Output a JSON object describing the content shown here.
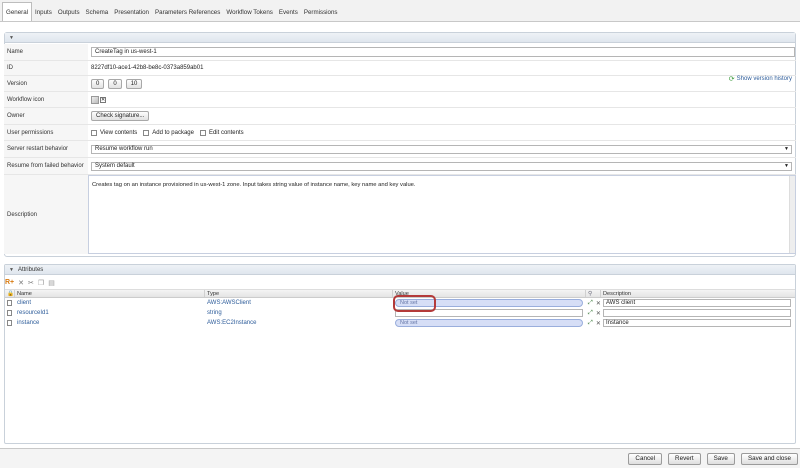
{
  "tabs": [
    "General",
    "Inputs",
    "Outputs",
    "Schema",
    "Presentation",
    "Parameters References",
    "Workflow Tokens",
    "Events",
    "Permissions"
  ],
  "general": {
    "name_label": "Name",
    "name_value": "CreateTag in us-west-1",
    "id_label": "ID",
    "id_value": "8227df10-ace1-42b8-be8c-0373a859ab01",
    "version_label": "Version",
    "version_parts": [
      "0",
      "0",
      "10"
    ],
    "show_version_history": "Show version history",
    "workflow_icon_label": "Workflow icon",
    "owner_label": "Owner",
    "check_signature": "Check signature...",
    "user_permissions_label": "User permissions",
    "permissions": [
      "View contents",
      "Add to package",
      "Edit contents"
    ],
    "server_restart_label": "Server restart behavior",
    "server_restart_value": "Resume workflow run",
    "resume_failed_label": "Resume from failed behavior",
    "resume_failed_value": "System default",
    "description_label": "Description",
    "description_value": "Creates tag on an instance provisioned in us-west-1 zone. Input takes string value of instance name, key name and key value."
  },
  "attributes": {
    "title": "Attributes",
    "columns": {
      "name": "Name",
      "type": "Type",
      "value": "Value",
      "description": "Description"
    },
    "rows": [
      {
        "name": "client",
        "type": "AWS:AWSClient",
        "value": "Not set",
        "description": "AWS client"
      },
      {
        "name": "resourceId1",
        "type": "string",
        "value": "",
        "description": ""
      },
      {
        "name": "instance",
        "type": "AWS:EC2Instance",
        "value": "Not set",
        "description": "Instance"
      }
    ]
  },
  "buttons": {
    "cancel": "Cancel",
    "revert": "Revert",
    "save": "Save",
    "save_close": "Save and close"
  },
  "colors": {
    "accent_link": "#2d5c9a",
    "highlight": "#b33a3a",
    "value_pill": "#d6def6"
  }
}
